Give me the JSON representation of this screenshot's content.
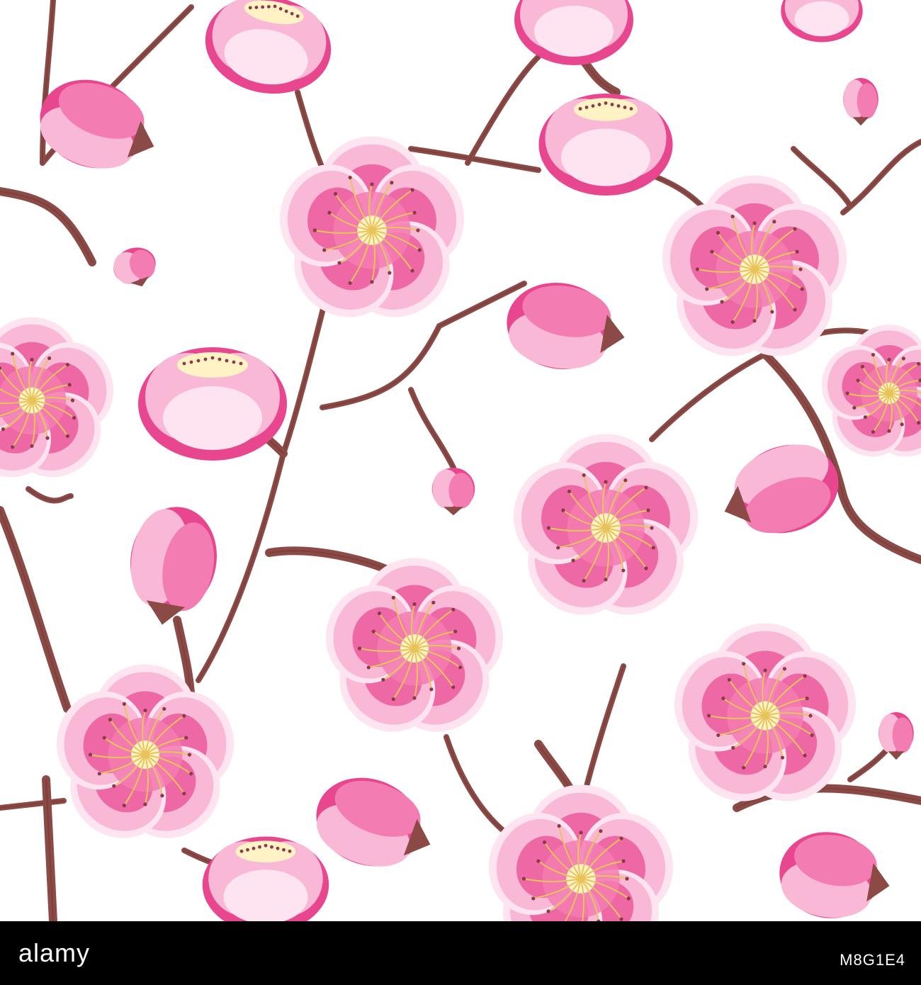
{
  "image": {
    "subject": "",
    "background_color": "#ffffff",
    "palette": {
      "petal_light": "#f9b8d6",
      "petal_mid": "#f37db2",
      "petal_deep": "#e8468f",
      "petal_edge": "#fde4f0",
      "center": "#fff2c4",
      "stamen": "#e7c45a",
      "anther": "#8a3a4a",
      "branch": "#8b4a46",
      "branch_dark": "#6e3634"
    }
  },
  "footer": {
    "logo_text": "alamy",
    "stock_id": "M8G1E4",
    "background": "#000000"
  }
}
